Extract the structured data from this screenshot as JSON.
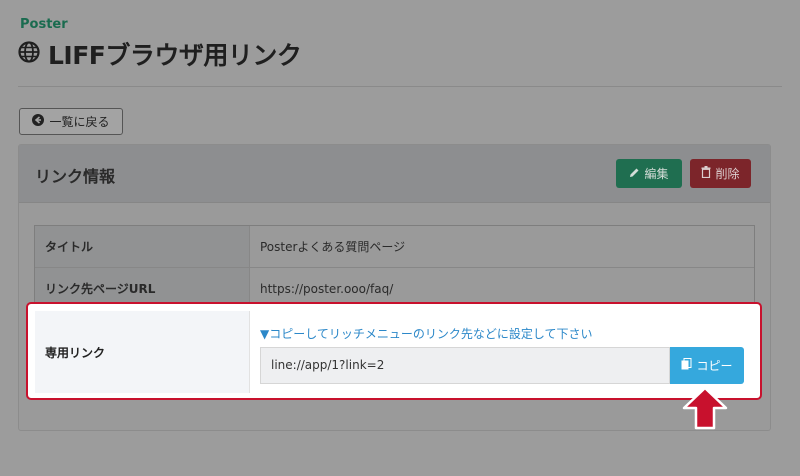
{
  "brand": "Poster",
  "page_title": "LIFFブラウザ用リンク",
  "back_button_label": "一覧に戻る",
  "card": {
    "title": "リンク情報",
    "edit_label": "編集",
    "delete_label": "削除"
  },
  "rows": [
    {
      "label": "タイトル",
      "value": "Posterよくある質問ページ"
    },
    {
      "label": "リンク先ページURL",
      "value": "https://poster.ooo/faq/"
    }
  ],
  "dedicated_link": {
    "label": "専用リンク",
    "hint": "▼コピーしてリッチメニューのリンク先などに設定して下さい",
    "value": "line://app/1?link=2",
    "copy_label": "コピー"
  },
  "icons": {
    "title": "globe-icon",
    "back": "arrow-circle-left-icon",
    "edit": "pencil-icon",
    "delete": "trash-icon",
    "copy": "copy-icon",
    "annotation": "red-up-arrow-icon"
  },
  "colors": {
    "highlight_border": "#c8112d",
    "hint_text": "#2c88c9",
    "copy_button": "#35a8dd",
    "edit_button": "#1f6e50",
    "delete_button": "#7c252a"
  }
}
